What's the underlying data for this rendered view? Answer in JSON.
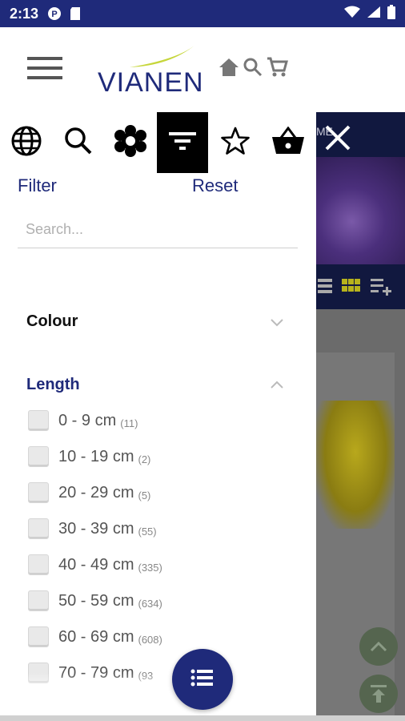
{
  "status_bar": {
    "time": "2:13"
  },
  "header": {
    "logo_text": "VIANEN",
    "brand_color": "#1f2a7a",
    "accent_color": "#c6d63a"
  },
  "drawer": {
    "tabs": [
      {
        "icon": "globe-icon"
      },
      {
        "icon": "search-icon"
      },
      {
        "icon": "flower-icon"
      },
      {
        "icon": "filter-icon",
        "active": true
      },
      {
        "icon": "star-icon"
      },
      {
        "icon": "basket-icon"
      }
    ],
    "filter_label": "Filter",
    "reset_label": "Reset",
    "search_placeholder": "Search...",
    "sections": [
      {
        "title": "Colour",
        "expanded": false
      },
      {
        "title": "Length",
        "expanded": true
      }
    ],
    "length_options": [
      {
        "label": "0 - 9 cm",
        "count": "(11)"
      },
      {
        "label": "10 - 19 cm",
        "count": "(2)"
      },
      {
        "label": "20 - 29 cm",
        "count": "(5)"
      },
      {
        "label": "30 - 39 cm",
        "count": "(55)"
      },
      {
        "label": "40 - 49 cm",
        "count": "(335)"
      },
      {
        "label": "50 - 59 cm",
        "count": "(634)"
      },
      {
        "label": "60 - 69 cm",
        "count": "(608)"
      },
      {
        "label": "70 - 79 cm",
        "count": "(93"
      }
    ]
  },
  "background_page": {
    "band_text": "ME"
  }
}
